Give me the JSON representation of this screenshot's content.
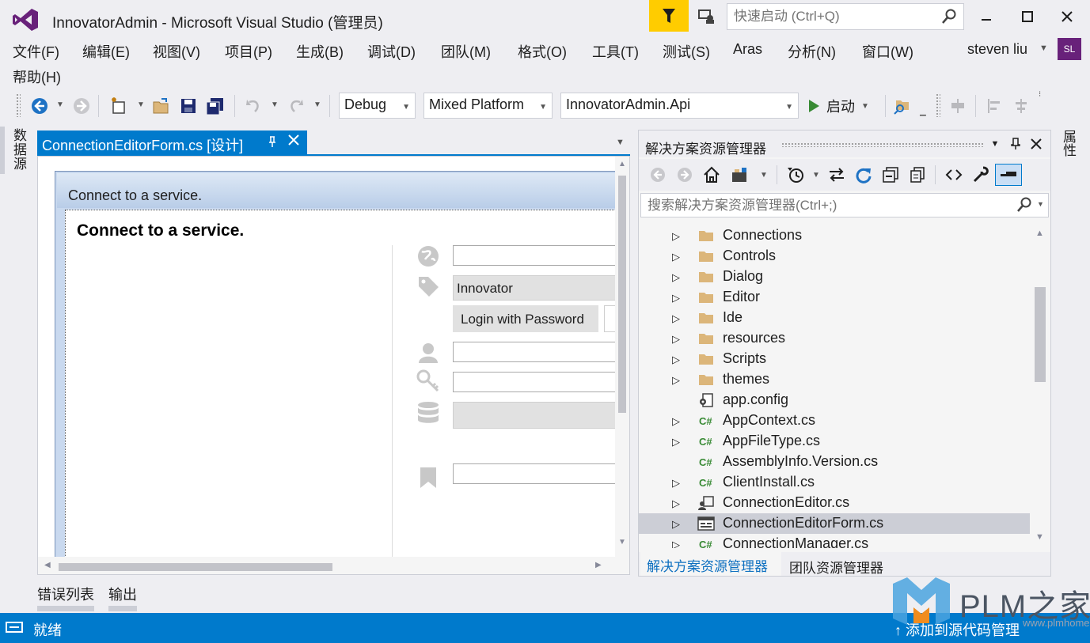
{
  "window": {
    "title": "InnovatorAdmin - Microsoft Visual Studio (管理员)",
    "quick_launch_placeholder": "快速启动 (Ctrl+Q)"
  },
  "menu": {
    "items": [
      "文件(F)",
      "编辑(E)",
      "视图(V)",
      "项目(P)",
      "生成(B)",
      "调试(D)",
      "团队(M)",
      "格式(O)",
      "工具(T)",
      "测试(S)",
      "Aras",
      "分析(N)",
      "窗口(W)"
    ],
    "help": "帮助(H)",
    "user_name": "steven liu",
    "user_initials": "SL"
  },
  "toolbar": {
    "config": "Debug",
    "platform": "Mixed Platform",
    "startup_project": "InnovatorAdmin.Api",
    "start_label": "启动"
  },
  "side_tabs": {
    "left": "数据源",
    "right": "属性"
  },
  "document": {
    "tab_label": "ConnectionEditorForm.cs [设计]"
  },
  "form": {
    "window_title": "Connect to a service.",
    "heading": "Connect to a service.",
    "type_value": "Innovator",
    "login_button": "Login with Password"
  },
  "bottom_tabs": [
    "错误列表",
    "输出"
  ],
  "solution_explorer": {
    "title": "解决方案资源管理器",
    "search_placeholder": "搜索解决方案资源管理器(Ctrl+;)",
    "items": [
      {
        "label": "Connections",
        "icon": "folder-icon",
        "expandable": true
      },
      {
        "label": "Controls",
        "icon": "folder-icon",
        "expandable": true
      },
      {
        "label": "Dialog",
        "icon": "folder-icon",
        "expandable": true
      },
      {
        "label": "Editor",
        "icon": "folder-icon",
        "expandable": true
      },
      {
        "label": "Ide",
        "icon": "folder-icon",
        "expandable": true
      },
      {
        "label": "resources",
        "icon": "folder-icon",
        "expandable": true
      },
      {
        "label": "Scripts",
        "icon": "folder-icon",
        "expandable": true
      },
      {
        "label": "themes",
        "icon": "folder-icon",
        "expandable": true
      },
      {
        "label": "app.config",
        "icon": "config-file-icon",
        "expandable": false
      },
      {
        "label": "AppContext.cs",
        "icon": "csharp-file-icon",
        "expandable": true
      },
      {
        "label": "AppFileType.cs",
        "icon": "csharp-file-icon",
        "expandable": true
      },
      {
        "label": "AssemblyInfo.Version.cs",
        "icon": "csharp-file-icon",
        "expandable": false
      },
      {
        "label": "ClientInstall.cs",
        "icon": "csharp-file-icon",
        "expandable": true
      },
      {
        "label": "ConnectionEditor.cs",
        "icon": "usercontrol-icon",
        "expandable": true
      },
      {
        "label": "ConnectionEditorForm.cs",
        "icon": "form-file-icon",
        "expandable": true,
        "selected": true
      },
      {
        "label": "ConnectionManager.cs",
        "icon": "csharp-file-icon",
        "expandable": true
      }
    ],
    "tabs": [
      "解决方案资源管理器",
      "团队资源管理器"
    ]
  },
  "status": {
    "text": "就绪",
    "source_control": "添加到源代码管理"
  },
  "watermark": {
    "text": "PLM之家",
    "url": "www.plmhome.com"
  },
  "colors": {
    "accent": "#007acc",
    "vs_purple": "#68217a",
    "feedback": "#ffcc00",
    "folder": "#dcb67a",
    "csharp": "#388a34"
  }
}
